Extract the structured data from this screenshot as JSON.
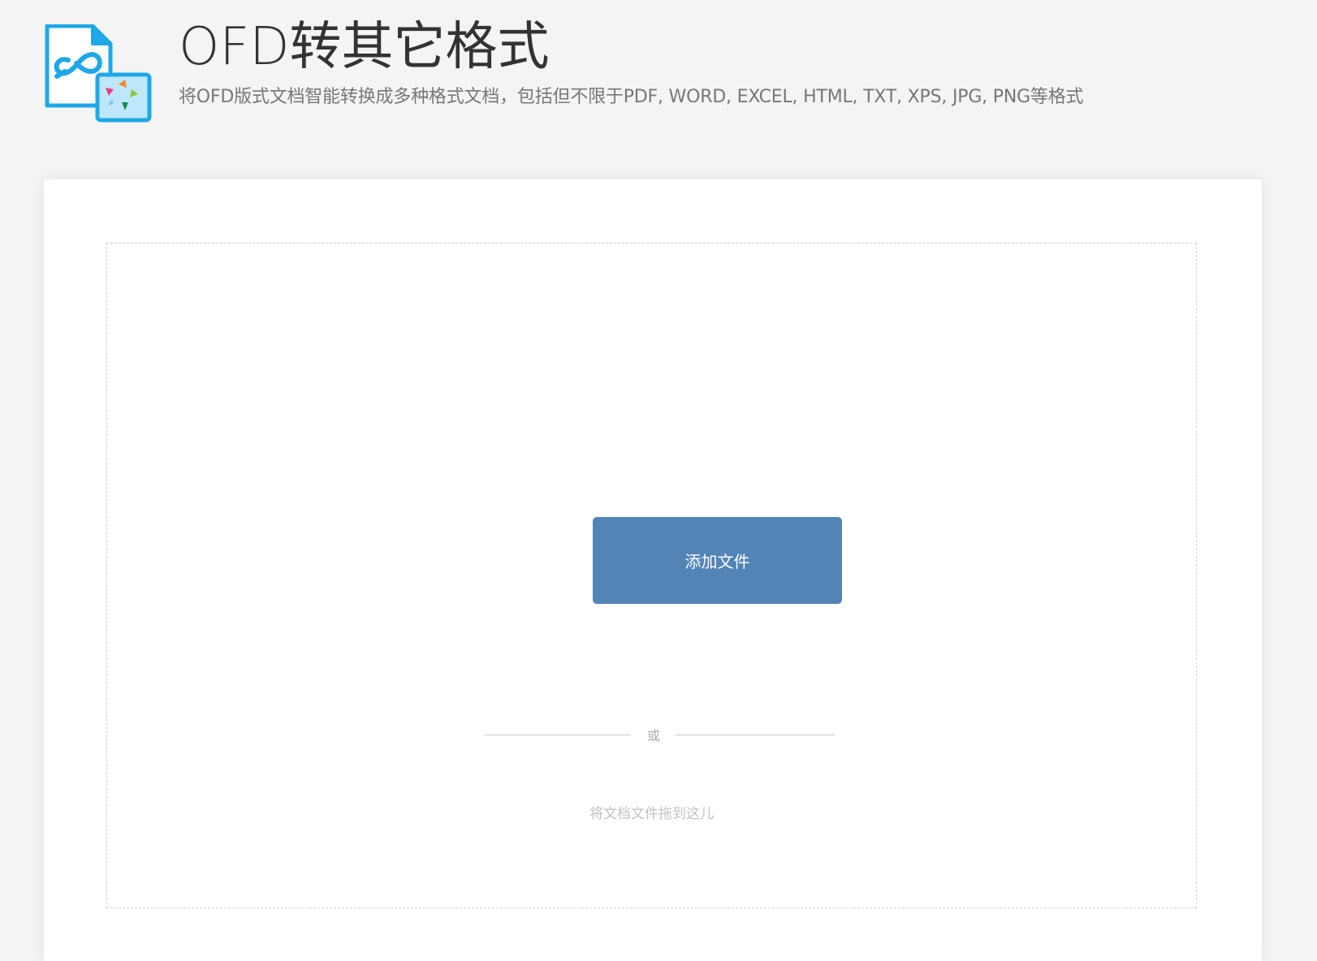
{
  "header": {
    "title": "OFD转其它格式",
    "subtitle": "将OFD版式文档智能转换成多种格式文档，包括但不限于PDF, WORD, EXCEL, HTML, TXT, XPS, JPG, PNG等格式",
    "logo_icon": "ofd-convert-logo-icon"
  },
  "upload": {
    "button_label": "添加文件",
    "divider_text": "或",
    "drop_hint": "将文档文件拖到这儿"
  },
  "colors": {
    "background": "#f4f4f4",
    "card": "#ffffff",
    "button": "#5284b6",
    "logo_blue": "#1fa8e8"
  }
}
